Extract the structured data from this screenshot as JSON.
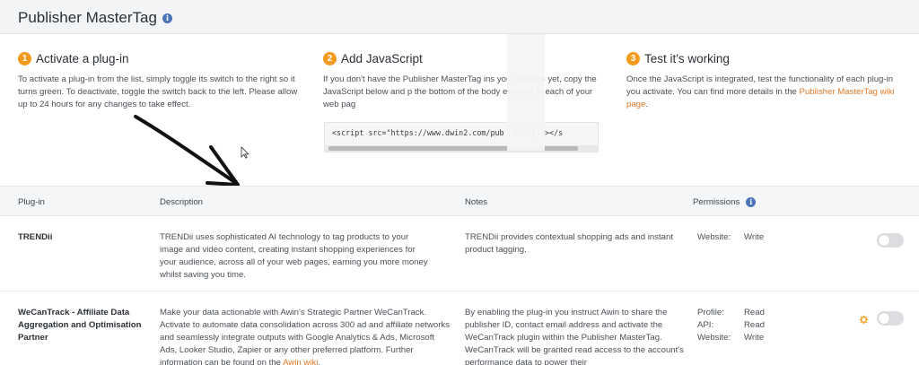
{
  "page": {
    "title": "Publisher MasterTag"
  },
  "steps": [
    {
      "number": "1",
      "heading": "Activate a plug-in",
      "text": "To activate a plug-in from the list, simply toggle its switch to the right so it turns green. To deactivate, toggle the switch back to the left. Please allow up to 24 hours for any changes to take effect."
    },
    {
      "number": "2",
      "heading": "Add JavaScript",
      "text": "If you don't have the Publisher MasterTag ins your website yet, copy the JavaScript below and p the bottom of the body element of each of your web pag",
      "code": "<script src=\"https://www.dwin2.com/pub .min.js\"></s"
    },
    {
      "number": "3",
      "heading": "Test it's working",
      "text_before_link": "Once the JavaScript is integrated, test the functionality of each plug-in you activate. You can find more details in the ",
      "link": "Publisher MasterTag wiki page",
      "text_after_link": "."
    }
  ],
  "table": {
    "headers": {
      "plugin": "Plug-in",
      "description": "Description",
      "notes": "Notes",
      "permissions": "Permissions"
    },
    "rows": [
      {
        "name": "TRENDii",
        "description": "TRENDii uses sophisticated AI technology to tag products to your image and video content, creating instant shopping experiences for your audience, across all of your web pages, earning you more money whilst saving you time.",
        "notes": "TRENDii provides contextual shopping ads and instant product tagging.",
        "permissions": [
          {
            "label": "Website:",
            "value": "Write"
          }
        ],
        "enabled": false
      },
      {
        "name": "WeCanTrack - Affiliate Data Aggregation and Optimisation Partner",
        "description_before_link": "Make your data actionable with Awin's Strategic Partner WeCanTrack. Activate to automate data consolidation across 300 ad and affiliate networks and seamlessly integrate outputs with Google Analytics & Ads, Microsoft Ads, Looker Studio, Zapier or any other preferred platform. Further information can be found on the ",
        "description_link": "Awin wiki",
        "description_after_link": ".",
        "notes": "By enabling the plug-in you instruct Awin to share the publisher ID, contact email address and activate the WeCanTrack plugin within the Publisher MasterTag. WeCanTrack will be granted read access to the account's performance data to power their",
        "permissions": [
          {
            "label": "Profile:",
            "value": "Read"
          },
          {
            "label": "API:",
            "value": "Read"
          },
          {
            "label": "Website:",
            "value": "Write"
          }
        ],
        "enabled": false
      }
    ]
  },
  "colors": {
    "accent_orange": "#f39a1d",
    "link_orange": "#e07a2a",
    "info_blue": "#4a73b8",
    "toggle_off": "#dcdde0"
  }
}
